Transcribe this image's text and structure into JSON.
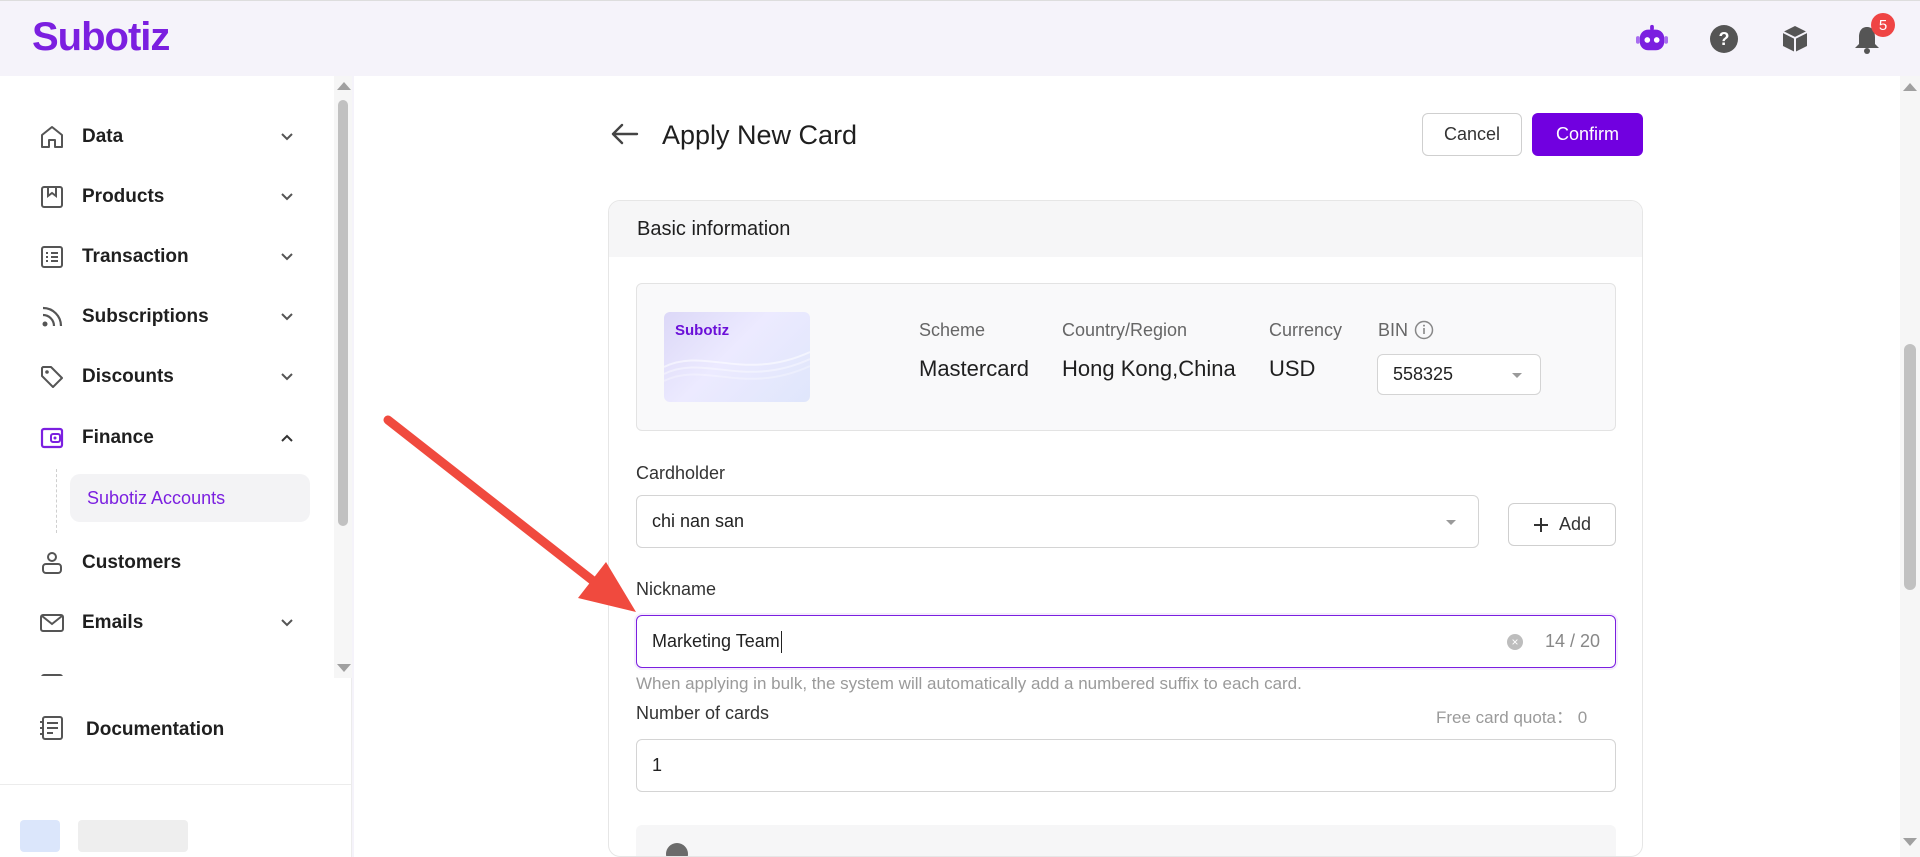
{
  "app": {
    "logo": "Subotiz"
  },
  "topbar": {
    "notification_count": "5"
  },
  "sidebar": {
    "items": [
      {
        "label": "Data",
        "icon": "home-icon"
      },
      {
        "label": "Products",
        "icon": "box-icon"
      },
      {
        "label": "Transaction",
        "icon": "list-icon"
      },
      {
        "label": "Subscriptions",
        "icon": "rss-icon"
      },
      {
        "label": "Discounts",
        "icon": "tag-icon"
      },
      {
        "label": "Finance",
        "icon": "wallet-icon"
      },
      {
        "label": "Customers",
        "icon": "user-icon"
      },
      {
        "label": "Emails",
        "icon": "mail-icon"
      }
    ],
    "finance_sub": {
      "label": "Subotiz Accounts"
    },
    "documentation": {
      "label": "Documentation"
    }
  },
  "page": {
    "title": "Apply New Card",
    "cancel_label": "Cancel",
    "confirm_label": "Confirm"
  },
  "basic_info": {
    "heading": "Basic information",
    "card_brand": "Subotiz",
    "scheme": {
      "label": "Scheme",
      "value": "Mastercard"
    },
    "country": {
      "label": "Country/Region",
      "value": "Hong Kong,China"
    },
    "currency": {
      "label": "Currency",
      "value": "USD"
    },
    "bin": {
      "label": "BIN",
      "value": "558325"
    }
  },
  "form": {
    "cardholder": {
      "label": "Cardholder",
      "value": "chi nan san",
      "add_label": "Add"
    },
    "nickname": {
      "label": "Nickname",
      "value": "Marketing Team",
      "counter": "14 / 20",
      "hint": "When applying in bulk, the system will automatically add a numbered suffix to each card."
    },
    "number_of_cards": {
      "label": "Number of cards",
      "value": "1",
      "quota": "Free card quota： 0"
    }
  },
  "colors": {
    "brand": "#7b1fe0",
    "confirm": "#7100e0",
    "annotation_arrow": "#f04a3e"
  }
}
